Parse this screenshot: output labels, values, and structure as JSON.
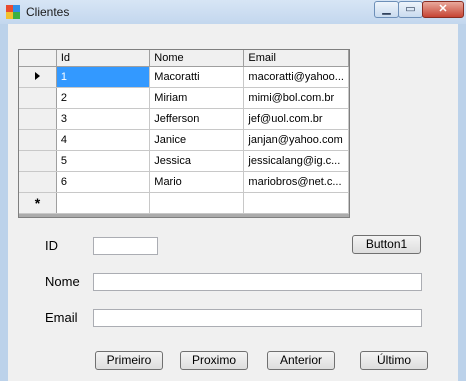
{
  "window": {
    "title": "Clientes",
    "minimize": "▁",
    "maximize": "▭",
    "close": "✕"
  },
  "grid": {
    "columns": [
      "Id",
      "Nome",
      "Email"
    ],
    "rows": [
      [
        "1",
        "Macoratti",
        "macoratti@yahoo..."
      ],
      [
        "2",
        "Miriam",
        "mimi@bol.com.br"
      ],
      [
        "3",
        "Jefferson",
        "jef@uol.com.br"
      ],
      [
        "4",
        "Janice",
        "janjan@yahoo.com"
      ],
      [
        "5",
        "Jessica",
        "jessicalang@ig.c..."
      ],
      [
        "6",
        "Mario",
        "mariobros@net.c..."
      ]
    ],
    "new_row_marker": "*"
  },
  "form": {
    "id_label": "ID",
    "nome_label": "Nome",
    "email_label": "Email",
    "id_value": "",
    "nome_value": "",
    "email_value": "",
    "button1": "Button1"
  },
  "nav": {
    "primeiro": "Primeiro",
    "proximo": "Proximo",
    "anterior": "Anterior",
    "ultimo": "Último"
  }
}
